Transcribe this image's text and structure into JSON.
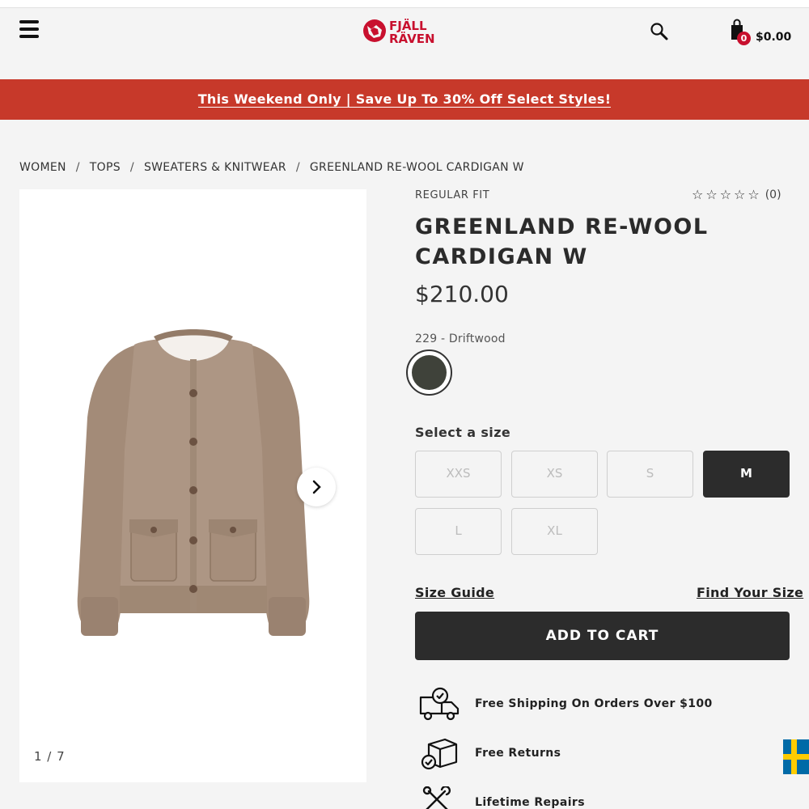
{
  "header": {
    "menu_icon": "hamburger-menu-icon",
    "brand_logo_text": "FJÄLL RÄVEN",
    "search_icon": "search-icon",
    "cart_icon": "shopping-bag-icon",
    "cart_count": "0",
    "cart_total": "$0.00"
  },
  "promo": {
    "text": "This Weekend Only | Save Up To 30% Off Select Styles!",
    "background": "#c7392a"
  },
  "breadcrumb": [
    "WOMEN",
    "TOPS",
    "SWEATERS & KNITWEAR",
    "GREENLAND RE-WOOL CARDIGAN W"
  ],
  "breadcrumb_separator": "/",
  "gallery": {
    "image_counter": "1 / 7",
    "next_icon": "chevron-right-icon"
  },
  "product": {
    "fit": "REGULAR FIT",
    "rating": {
      "stars": 0,
      "max": 5,
      "count_label": "(0)"
    },
    "name": "Greenland Re-Wool Cardigan W",
    "price": "$210.00",
    "color_label": "229 - Driftwood",
    "swatch_color": "#3f423a"
  },
  "sizes": {
    "label": "Select a size",
    "options": [
      "XXS",
      "XS",
      "S",
      "M",
      "L",
      "XL"
    ],
    "selected": "M"
  },
  "links": {
    "size_guide": "Size Guide",
    "find_your_size": "Find Your Size"
  },
  "cart_button": {
    "label": "ADD TO CART"
  },
  "perks": [
    {
      "icon": "delivery-truck-icon",
      "text": "Free Shipping On Orders Over $100"
    },
    {
      "icon": "return-box-icon",
      "text": "Free Returns"
    },
    {
      "icon": "repair-tools-icon",
      "text": "Lifetime Repairs"
    }
  ],
  "locale_flag": "sweden-flag-icon"
}
